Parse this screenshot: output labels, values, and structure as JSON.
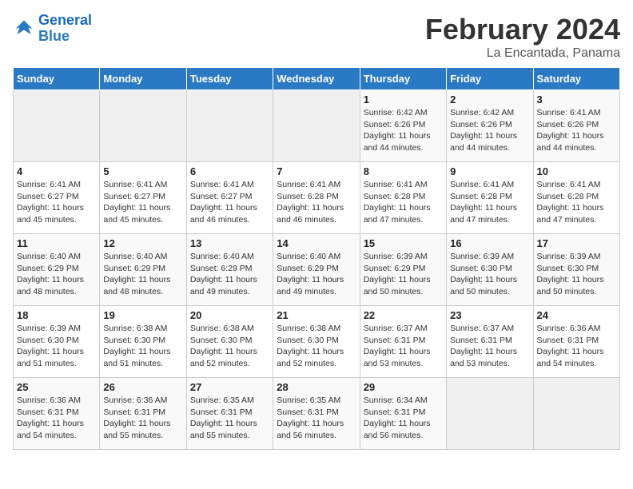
{
  "logo": {
    "line1": "General",
    "line2": "Blue"
  },
  "title": "February 2024",
  "subtitle": "La Encantada, Panama",
  "days_header": [
    "Sunday",
    "Monday",
    "Tuesday",
    "Wednesday",
    "Thursday",
    "Friday",
    "Saturday"
  ],
  "weeks": [
    [
      {
        "day": "",
        "info": ""
      },
      {
        "day": "",
        "info": ""
      },
      {
        "day": "",
        "info": ""
      },
      {
        "day": "",
        "info": ""
      },
      {
        "day": "1",
        "info": "Sunrise: 6:42 AM\nSunset: 6:26 PM\nDaylight: 11 hours and 44 minutes."
      },
      {
        "day": "2",
        "info": "Sunrise: 6:42 AM\nSunset: 6:26 PM\nDaylight: 11 hours and 44 minutes."
      },
      {
        "day": "3",
        "info": "Sunrise: 6:41 AM\nSunset: 6:26 PM\nDaylight: 11 hours and 44 minutes."
      }
    ],
    [
      {
        "day": "4",
        "info": "Sunrise: 6:41 AM\nSunset: 6:27 PM\nDaylight: 11 hours and 45 minutes."
      },
      {
        "day": "5",
        "info": "Sunrise: 6:41 AM\nSunset: 6:27 PM\nDaylight: 11 hours and 45 minutes."
      },
      {
        "day": "6",
        "info": "Sunrise: 6:41 AM\nSunset: 6:27 PM\nDaylight: 11 hours and 46 minutes."
      },
      {
        "day": "7",
        "info": "Sunrise: 6:41 AM\nSunset: 6:28 PM\nDaylight: 11 hours and 46 minutes."
      },
      {
        "day": "8",
        "info": "Sunrise: 6:41 AM\nSunset: 6:28 PM\nDaylight: 11 hours and 47 minutes."
      },
      {
        "day": "9",
        "info": "Sunrise: 6:41 AM\nSunset: 6:28 PM\nDaylight: 11 hours and 47 minutes."
      },
      {
        "day": "10",
        "info": "Sunrise: 6:41 AM\nSunset: 6:28 PM\nDaylight: 11 hours and 47 minutes."
      }
    ],
    [
      {
        "day": "11",
        "info": "Sunrise: 6:40 AM\nSunset: 6:29 PM\nDaylight: 11 hours and 48 minutes."
      },
      {
        "day": "12",
        "info": "Sunrise: 6:40 AM\nSunset: 6:29 PM\nDaylight: 11 hours and 48 minutes."
      },
      {
        "day": "13",
        "info": "Sunrise: 6:40 AM\nSunset: 6:29 PM\nDaylight: 11 hours and 49 minutes."
      },
      {
        "day": "14",
        "info": "Sunrise: 6:40 AM\nSunset: 6:29 PM\nDaylight: 11 hours and 49 minutes."
      },
      {
        "day": "15",
        "info": "Sunrise: 6:39 AM\nSunset: 6:29 PM\nDaylight: 11 hours and 50 minutes."
      },
      {
        "day": "16",
        "info": "Sunrise: 6:39 AM\nSunset: 6:30 PM\nDaylight: 11 hours and 50 minutes."
      },
      {
        "day": "17",
        "info": "Sunrise: 6:39 AM\nSunset: 6:30 PM\nDaylight: 11 hours and 50 minutes."
      }
    ],
    [
      {
        "day": "18",
        "info": "Sunrise: 6:39 AM\nSunset: 6:30 PM\nDaylight: 11 hours and 51 minutes."
      },
      {
        "day": "19",
        "info": "Sunrise: 6:38 AM\nSunset: 6:30 PM\nDaylight: 11 hours and 51 minutes."
      },
      {
        "day": "20",
        "info": "Sunrise: 6:38 AM\nSunset: 6:30 PM\nDaylight: 11 hours and 52 minutes."
      },
      {
        "day": "21",
        "info": "Sunrise: 6:38 AM\nSunset: 6:30 PM\nDaylight: 11 hours and 52 minutes."
      },
      {
        "day": "22",
        "info": "Sunrise: 6:37 AM\nSunset: 6:31 PM\nDaylight: 11 hours and 53 minutes."
      },
      {
        "day": "23",
        "info": "Sunrise: 6:37 AM\nSunset: 6:31 PM\nDaylight: 11 hours and 53 minutes."
      },
      {
        "day": "24",
        "info": "Sunrise: 6:36 AM\nSunset: 6:31 PM\nDaylight: 11 hours and 54 minutes."
      }
    ],
    [
      {
        "day": "25",
        "info": "Sunrise: 6:36 AM\nSunset: 6:31 PM\nDaylight: 11 hours and 54 minutes."
      },
      {
        "day": "26",
        "info": "Sunrise: 6:36 AM\nSunset: 6:31 PM\nDaylight: 11 hours and 55 minutes."
      },
      {
        "day": "27",
        "info": "Sunrise: 6:35 AM\nSunset: 6:31 PM\nDaylight: 11 hours and 55 minutes."
      },
      {
        "day": "28",
        "info": "Sunrise: 6:35 AM\nSunset: 6:31 PM\nDaylight: 11 hours and 56 minutes."
      },
      {
        "day": "29",
        "info": "Sunrise: 6:34 AM\nSunset: 6:31 PM\nDaylight: 11 hours and 56 minutes."
      },
      {
        "day": "",
        "info": ""
      },
      {
        "day": "",
        "info": ""
      }
    ]
  ]
}
